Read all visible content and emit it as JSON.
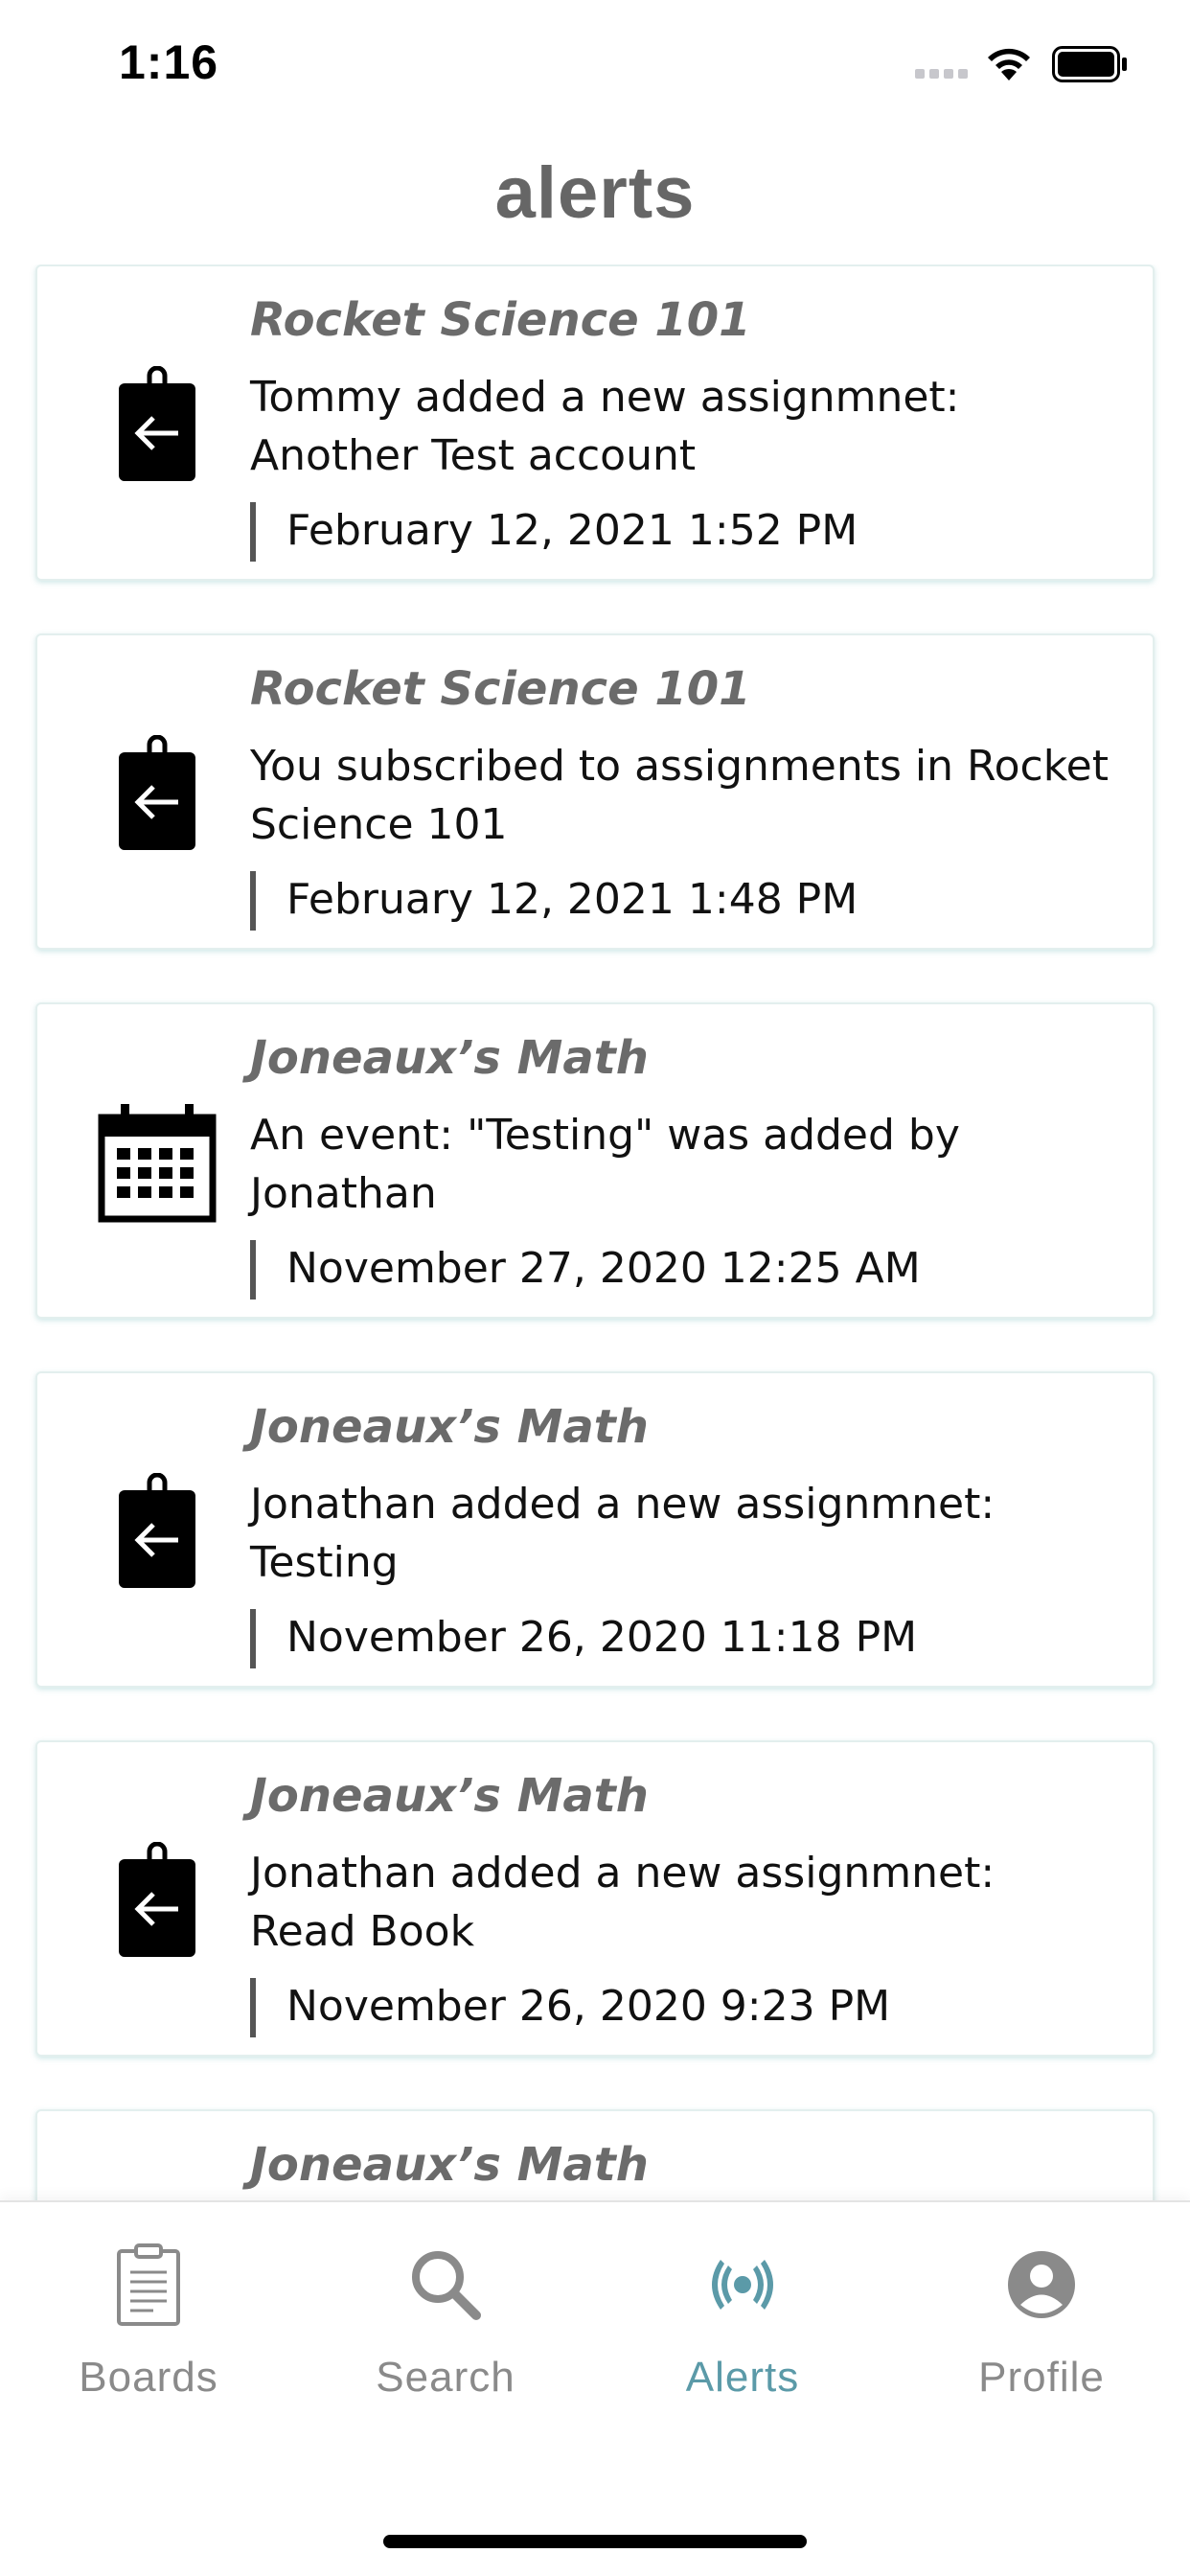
{
  "status_bar": {
    "time": "1:16"
  },
  "header": {
    "title": "alerts"
  },
  "alerts": [
    {
      "icon": "clipboard-return-icon",
      "board": "Rocket Science 101",
      "message": "Tommy added a new assignmnet: Another Test account",
      "date": "February 12, 2021 1:52 PM"
    },
    {
      "icon": "clipboard-return-icon",
      "board": "Rocket Science 101",
      "message": "You subscribed to assignments in Rocket Science 101",
      "date": "February 12, 2021 1:48 PM"
    },
    {
      "icon": "calendar-icon",
      "board": "Joneaux’s Math",
      "message": "An event: \"Testing\" was added by Jonathan",
      "date": "November 27, 2020 12:25 AM"
    },
    {
      "icon": "clipboard-return-icon",
      "board": "Joneaux’s Math",
      "message": "Jonathan added a new assignmnet: Testing",
      "date": "November 26, 2020 11:18 PM"
    },
    {
      "icon": "clipboard-return-icon",
      "board": "Joneaux’s Math",
      "message": "Jonathan added a new assignmnet: Read Book",
      "date": "November 26, 2020 9:23 PM"
    },
    {
      "icon": "calendar-icon",
      "board": "Joneaux’s Math",
      "message": "",
      "date": ""
    }
  ],
  "tab_bar": {
    "tabs": [
      {
        "label": "Boards",
        "icon": "clipboard-icon",
        "active": false
      },
      {
        "label": "Search",
        "icon": "search-icon",
        "active": false
      },
      {
        "label": "Alerts",
        "icon": "broadcast-icon",
        "active": true
      },
      {
        "label": "Profile",
        "icon": "user-circle-icon",
        "active": false
      }
    ]
  },
  "colors": {
    "title": "#666666",
    "board_name": "#6b6b6b",
    "tab_inactive": "#8a8a8a",
    "tab_active": "#5b9aa8",
    "card_border": "#e3efee"
  }
}
